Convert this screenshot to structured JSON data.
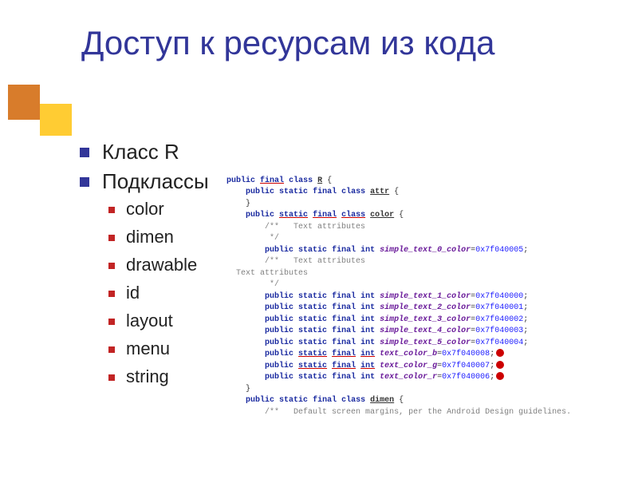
{
  "title": "Доступ к ресурсам из кода",
  "bullets": {
    "l1": [
      "Класс R",
      "Подклассы"
    ],
    "l2": [
      "color",
      "dimen",
      "drawable",
      "id",
      "layout",
      "menu",
      "string"
    ]
  },
  "kw": {
    "public": "public",
    "final": "final",
    "class": "class",
    "static": "static",
    "int": "int"
  },
  "classes": {
    "R": "R",
    "attr": "attr",
    "color": "color",
    "dimen": "dimen"
  },
  "comments": {
    "open": "/**",
    "close": " */",
    "textAttr": "Text attributes",
    "dimenComment": "Default screen margins, per the Android Design guidelines."
  },
  "fields": {
    "f0": {
      "name": "simple_text_0_color",
      "val": "0x7f040005"
    },
    "f1": {
      "name": "simple_text_1_color",
      "val": "0x7f040000"
    },
    "f2": {
      "name": "simple_text_2_color",
      "val": "0x7f040001"
    },
    "f3": {
      "name": "simple_text_3_color",
      "val": "0x7f040002"
    },
    "f4": {
      "name": "simple_text_4_color",
      "val": "0x7f040003"
    },
    "f5": {
      "name": "simple_text_5_color",
      "val": "0x7f040004"
    },
    "fb": {
      "name": "text_color_b",
      "val": "0x7f040008"
    },
    "fg": {
      "name": "text_color_g",
      "val": "0x7f040007"
    },
    "fr": {
      "name": "text_color_r",
      "val": "0x7f040006"
    }
  },
  "punct": {
    "ob": "{",
    "cb": "}",
    "eq": "=",
    "semi": ";"
  }
}
